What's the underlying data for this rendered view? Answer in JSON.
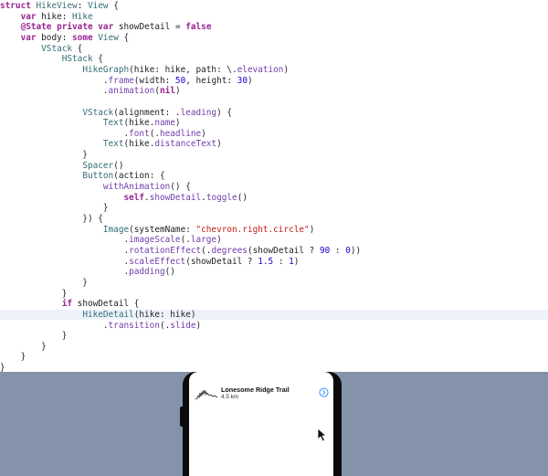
{
  "code_lines": [
    [
      {
        "t": "struct",
        "c": "kw"
      },
      {
        "t": " ",
        "c": "plain"
      },
      {
        "t": "HikeView",
        "c": "ty"
      },
      {
        "t": ": ",
        "c": "plain"
      },
      {
        "t": "View",
        "c": "fn"
      },
      {
        "t": " {",
        "c": "plain"
      }
    ],
    [
      {
        "t": "    ",
        "c": "plain"
      },
      {
        "t": "var",
        "c": "kw"
      },
      {
        "t": " hike: ",
        "c": "plain"
      },
      {
        "t": "Hike",
        "c": "fn"
      }
    ],
    [
      {
        "t": "    ",
        "c": "plain"
      },
      {
        "t": "@State",
        "c": "kw"
      },
      {
        "t": " ",
        "c": "plain"
      },
      {
        "t": "private",
        "c": "kw"
      },
      {
        "t": " ",
        "c": "plain"
      },
      {
        "t": "var",
        "c": "kw"
      },
      {
        "t": " showDetail = ",
        "c": "plain"
      },
      {
        "t": "false",
        "c": "kw"
      }
    ],
    [
      {
        "t": "    ",
        "c": "plain"
      },
      {
        "t": "var",
        "c": "kw"
      },
      {
        "t": " body: ",
        "c": "plain"
      },
      {
        "t": "some",
        "c": "kw"
      },
      {
        "t": " ",
        "c": "plain"
      },
      {
        "t": "View",
        "c": "fn"
      },
      {
        "t": " {",
        "c": "plain"
      }
    ],
    [
      {
        "t": "        ",
        "c": "plain"
      },
      {
        "t": "VStack",
        "c": "fn"
      },
      {
        "t": " {",
        "c": "plain"
      }
    ],
    [
      {
        "t": "            ",
        "c": "plain"
      },
      {
        "t": "HStack",
        "c": "fn"
      },
      {
        "t": " {",
        "c": "plain"
      }
    ],
    [
      {
        "t": "                ",
        "c": "plain"
      },
      {
        "t": "HikeGraph",
        "c": "fn"
      },
      {
        "t": "(hike: hike, path: \\.",
        "c": "plain"
      },
      {
        "t": "elevation",
        "c": "mem"
      },
      {
        "t": ")",
        "c": "plain"
      }
    ],
    [
      {
        "t": "                    .",
        "c": "plain"
      },
      {
        "t": "frame",
        "c": "mem"
      },
      {
        "t": "(width: ",
        "c": "plain"
      },
      {
        "t": "50",
        "c": "num"
      },
      {
        "t": ", height: ",
        "c": "plain"
      },
      {
        "t": "30",
        "c": "num"
      },
      {
        "t": ")",
        "c": "plain"
      }
    ],
    [
      {
        "t": "                    .",
        "c": "plain"
      },
      {
        "t": "animation",
        "c": "mem"
      },
      {
        "t": "(",
        "c": "plain"
      },
      {
        "t": "nil",
        "c": "kw"
      },
      {
        "t": ")",
        "c": "plain"
      }
    ],
    [],
    [
      {
        "t": "                ",
        "c": "plain"
      },
      {
        "t": "VStack",
        "c": "fn"
      },
      {
        "t": "(alignment: .",
        "c": "plain"
      },
      {
        "t": "leading",
        "c": "mem"
      },
      {
        "t": ") {",
        "c": "plain"
      }
    ],
    [
      {
        "t": "                    ",
        "c": "plain"
      },
      {
        "t": "Text",
        "c": "fn"
      },
      {
        "t": "(hike.",
        "c": "plain"
      },
      {
        "t": "name",
        "c": "mem"
      },
      {
        "t": ")",
        "c": "plain"
      }
    ],
    [
      {
        "t": "                        .",
        "c": "plain"
      },
      {
        "t": "font",
        "c": "mem"
      },
      {
        "t": "(.",
        "c": "plain"
      },
      {
        "t": "headline",
        "c": "mem"
      },
      {
        "t": ")",
        "c": "plain"
      }
    ],
    [
      {
        "t": "                    ",
        "c": "plain"
      },
      {
        "t": "Text",
        "c": "fn"
      },
      {
        "t": "(hike.",
        "c": "plain"
      },
      {
        "t": "distanceText",
        "c": "mem"
      },
      {
        "t": ")",
        "c": "plain"
      }
    ],
    [
      {
        "t": "                }",
        "c": "plain"
      }
    ],
    [
      {
        "t": "                ",
        "c": "plain"
      },
      {
        "t": "Spacer",
        "c": "fn"
      },
      {
        "t": "()",
        "c": "plain"
      }
    ],
    [
      {
        "t": "                ",
        "c": "plain"
      },
      {
        "t": "Button",
        "c": "fn"
      },
      {
        "t": "(action: {",
        "c": "plain"
      }
    ],
    [
      {
        "t": "                    ",
        "c": "plain"
      },
      {
        "t": "withAnimation",
        "c": "mem"
      },
      {
        "t": "() {",
        "c": "plain"
      }
    ],
    [
      {
        "t": "                        ",
        "c": "plain"
      },
      {
        "t": "self",
        "c": "kw"
      },
      {
        "t": ".",
        "c": "plain"
      },
      {
        "t": "showDetail",
        "c": "mem"
      },
      {
        "t": ".",
        "c": "plain"
      },
      {
        "t": "toggle",
        "c": "mem"
      },
      {
        "t": "()",
        "c": "plain"
      }
    ],
    [
      {
        "t": "                    }",
        "c": "plain"
      }
    ],
    [
      {
        "t": "                }) {",
        "c": "plain"
      }
    ],
    [
      {
        "t": "                    ",
        "c": "plain"
      },
      {
        "t": "Image",
        "c": "fn"
      },
      {
        "t": "(systemName: ",
        "c": "plain"
      },
      {
        "t": "\"chevron.right.circle\"",
        "c": "str"
      },
      {
        "t": ")",
        "c": "plain"
      }
    ],
    [
      {
        "t": "                        .",
        "c": "plain"
      },
      {
        "t": "imageScale",
        "c": "mem"
      },
      {
        "t": "(.",
        "c": "plain"
      },
      {
        "t": "large",
        "c": "mem"
      },
      {
        "t": ")",
        "c": "plain"
      }
    ],
    [
      {
        "t": "                        .",
        "c": "plain"
      },
      {
        "t": "rotationEffect",
        "c": "mem"
      },
      {
        "t": "(.",
        "c": "plain"
      },
      {
        "t": "degrees",
        "c": "mem"
      },
      {
        "t": "(showDetail ? ",
        "c": "plain"
      },
      {
        "t": "90",
        "c": "num"
      },
      {
        "t": " : ",
        "c": "plain"
      },
      {
        "t": "0",
        "c": "num"
      },
      {
        "t": "))",
        "c": "plain"
      }
    ],
    [
      {
        "t": "                        .",
        "c": "plain"
      },
      {
        "t": "scaleEffect",
        "c": "mem"
      },
      {
        "t": "(showDetail ? ",
        "c": "plain"
      },
      {
        "t": "1.5",
        "c": "num"
      },
      {
        "t": " : ",
        "c": "plain"
      },
      {
        "t": "1",
        "c": "num"
      },
      {
        "t": ")",
        "c": "plain"
      }
    ],
    [
      {
        "t": "                        .",
        "c": "plain"
      },
      {
        "t": "padding",
        "c": "mem"
      },
      {
        "t": "()",
        "c": "plain"
      }
    ],
    [
      {
        "t": "                }",
        "c": "plain"
      }
    ],
    [
      {
        "t": "            }",
        "c": "plain"
      }
    ],
    [
      {
        "t": "            ",
        "c": "plain"
      },
      {
        "t": "if",
        "c": "kw"
      },
      {
        "t": " showDetail {",
        "c": "plain"
      }
    ],
    [
      {
        "t": "                ",
        "c": "plain"
      },
      {
        "t": "HikeDetail",
        "c": "fn"
      },
      {
        "t": "(hike: hike)",
        "c": "plain"
      }
    ],
    [
      {
        "t": "                    .",
        "c": "plain"
      },
      {
        "t": "transition",
        "c": "mem"
      },
      {
        "t": "(.",
        "c": "plain"
      },
      {
        "t": "slide",
        "c": "mem"
      },
      {
        "t": ")",
        "c": "plain"
      }
    ],
    [
      {
        "t": "            }",
        "c": "plain"
      }
    ],
    [
      {
        "t": "        }",
        "c": "plain"
      }
    ],
    [
      {
        "t": "    }",
        "c": "plain"
      }
    ],
    [
      {
        "t": "}",
        "c": "plain"
      }
    ]
  ],
  "highlighted_line": 29,
  "preview": {
    "hike_name": "Lonesome Ridge Trail",
    "hike_distance": "4.5 km",
    "graph_icon": "hike-graph",
    "toggle_icon": "chevron-right-circle-icon",
    "accent_color": "#0a7aff"
  },
  "colors": {
    "simulator_background": "#8493a9",
    "editor_background": "#ffffff",
    "line_highlight": "#edf2fb"
  }
}
